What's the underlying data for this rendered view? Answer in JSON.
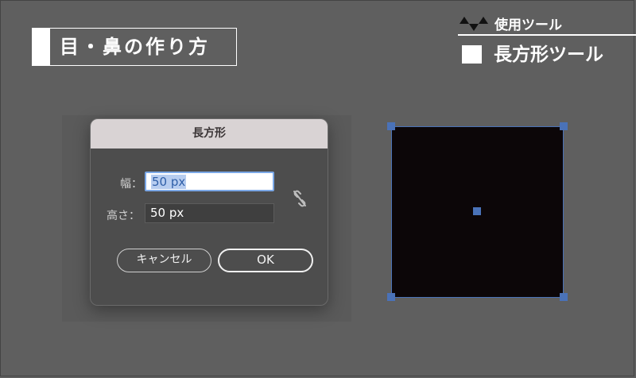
{
  "title": {
    "text": "目・鼻の作り方"
  },
  "tool": {
    "heading": "使用ツール",
    "name": "長方形ツール"
  },
  "dialog": {
    "title": "長方形",
    "width_label": "幅：",
    "width_value": "50 px",
    "height_label": "高さ：",
    "height_value": "50 px",
    "cancel_label": "キャンセル",
    "ok_label": "OK",
    "link_icon": "unlink-icon"
  },
  "canvas": {
    "rect_fill": "#0c0608",
    "selection_color": "#4a72b8"
  }
}
